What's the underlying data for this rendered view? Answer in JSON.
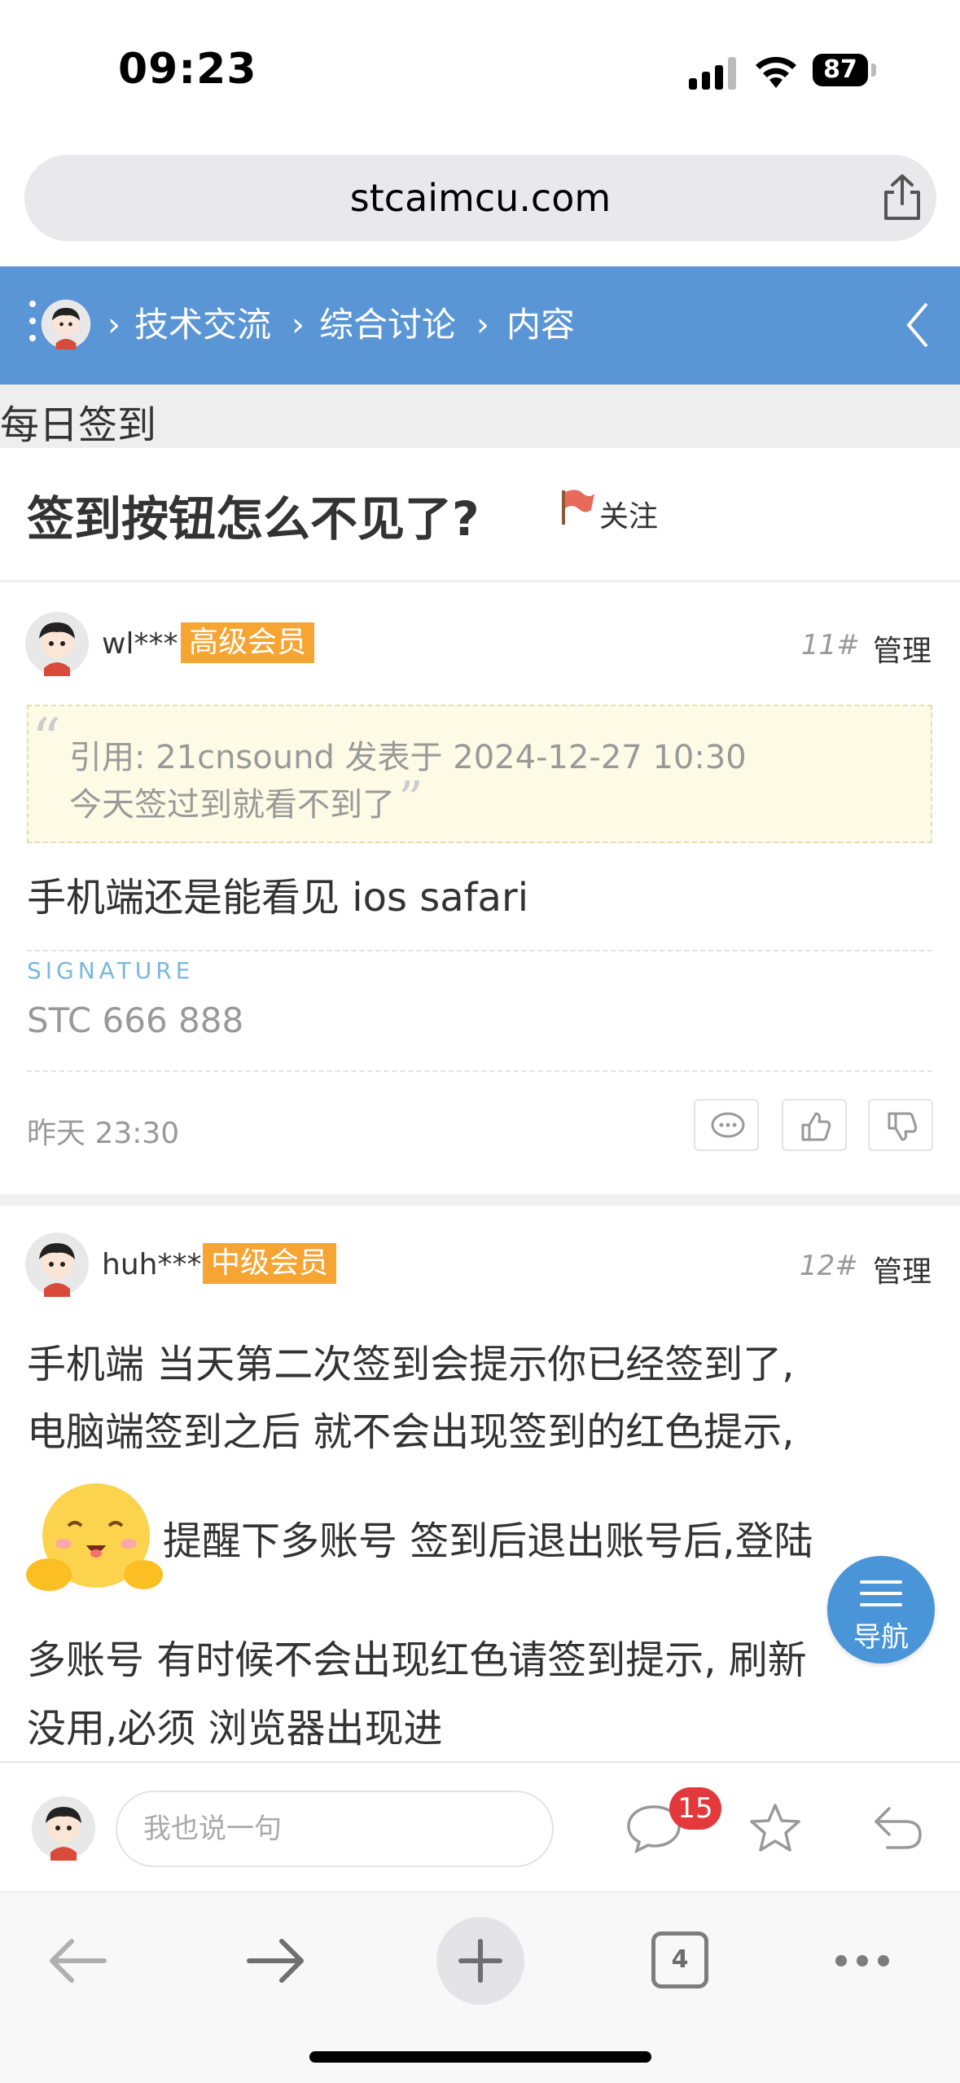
{
  "status_bar": {
    "time": "09:23",
    "battery": "87"
  },
  "browser": {
    "url": "stcaimcu.com",
    "tab_count": "4"
  },
  "breadcrumb": {
    "sep": "›",
    "items": [
      "技术交流",
      "综合讨论",
      "内容"
    ]
  },
  "section": "每日签到",
  "thread": {
    "title": "签到按钮怎么不见了?",
    "follow_label": "关注"
  },
  "posts": [
    {
      "username": "wl***",
      "rank": "高级会员",
      "rank_color": "#f6a432",
      "floor": "11#",
      "manage": "管理",
      "quote_line1": "引用: 21cnsound 发表于 2024-12-27 10:30",
      "quote_line2": "今天签过到就看不到了",
      "content": "手机端还是能看见 ios safari",
      "signature_label": "SIGNATURE",
      "signature": "STC 666 888",
      "time": "昨天 23:30"
    },
    {
      "username": "huh***",
      "rank": "中级会员",
      "rank_color": "#f6a432",
      "floor": "12#",
      "manage": "管理",
      "lines": [
        "手机端 当天第二次签到会提示你已经签到了,",
        "电脑端签到之后 就不会出现签到的红色提示,",
        "提醒下多账号  签到后退出账号后,登陆",
        "多账号 有时候不会出现红色请签到提示,  刷新",
        "没用,必须 浏览器出现进"
      ]
    }
  ],
  "fab_label": "导航",
  "reply": {
    "placeholder": "我也说一句",
    "comment_count": "15"
  },
  "colors": {
    "nav_bg": "#5a96d6",
    "badge_red": "#e4393c",
    "fab_bg": "#4a94d8"
  }
}
